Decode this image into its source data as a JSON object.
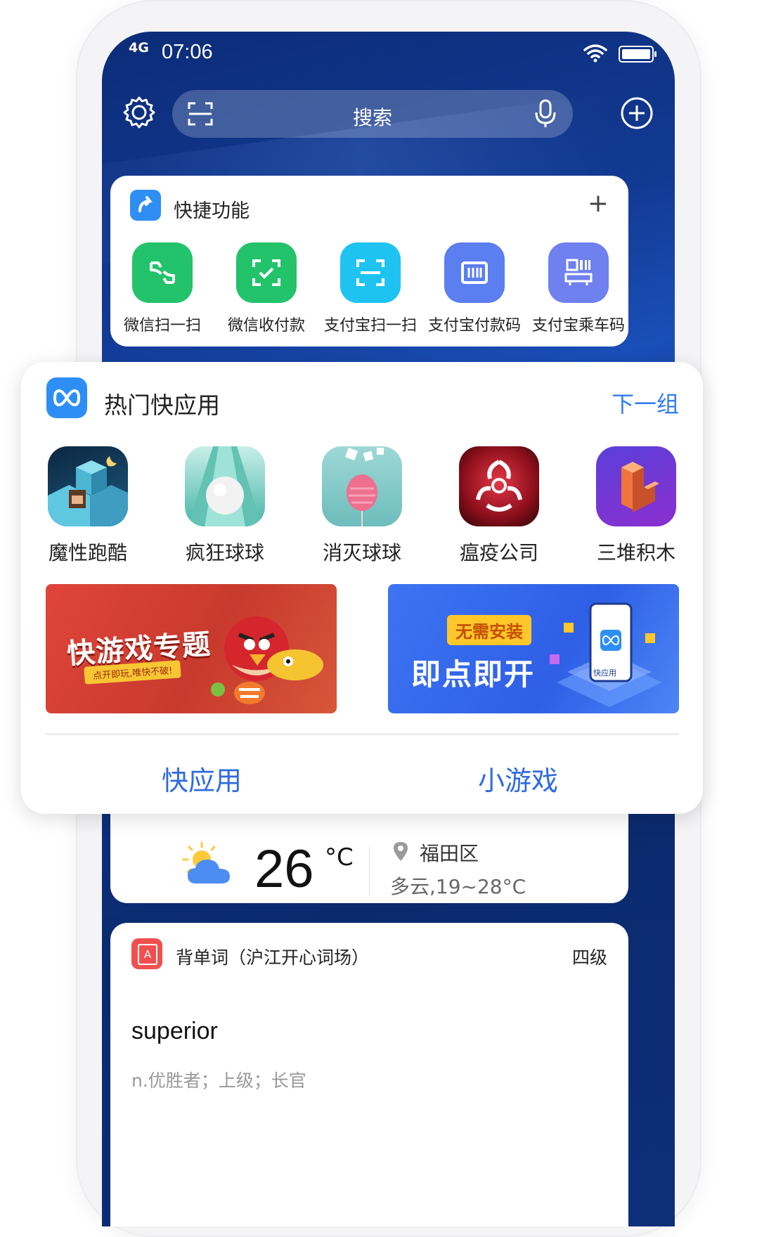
{
  "status_bar": {
    "network": "4G",
    "time": "07:06"
  },
  "search": {
    "placeholder": "搜索"
  },
  "shortcuts": {
    "title": "快捷功能",
    "add_label": "+",
    "items": [
      {
        "label": "微信扫一扫",
        "icon": "wechat-scan-icon",
        "color": "#22c36a"
      },
      {
        "label": "微信收付款",
        "icon": "wechat-pay-icon",
        "color": "#22c36a"
      },
      {
        "label": "支付宝扫一扫",
        "icon": "alipay-scan-icon",
        "color": "#1fc3f2"
      },
      {
        "label": "支付宝付款码",
        "icon": "alipay-paycode-icon",
        "color": "#5b7ef0"
      },
      {
        "label": "支付宝乘车码",
        "icon": "alipay-bus-code-icon",
        "color": "#6f80ef"
      }
    ]
  },
  "quick_apps": {
    "title": "热门快应用",
    "next_label": "下一组",
    "apps": [
      {
        "name": "魔性跑酷",
        "icon": "parkour-game-icon"
      },
      {
        "name": "疯狂球球",
        "icon": "crazy-ball-game-icon"
      },
      {
        "name": "消灭球球",
        "icon": "pop-ball-game-icon"
      },
      {
        "name": "瘟疫公司",
        "icon": "plague-inc-icon"
      },
      {
        "name": "三堆积木",
        "icon": "stack-blocks-game-icon"
      }
    ],
    "banners": [
      {
        "title": "快游戏专题",
        "subtitle": "点开即玩,唯快不破!"
      },
      {
        "badge": "无需安装",
        "title": "即点即开",
        "phone_caption": "快应用"
      }
    ],
    "tabs": [
      "快应用",
      "小游戏"
    ]
  },
  "weather": {
    "temperature": "26",
    "unit": "°C",
    "location": "福田区",
    "description": "多云,19~28°C"
  },
  "vocab": {
    "title": "背单词（沪江开心词场）",
    "level": "四级",
    "word": "superior",
    "definition": "n.优胜者；上级；长官"
  },
  "colors": {
    "accent": "#2f7cf6",
    "wallpaper": "#0f3486"
  }
}
